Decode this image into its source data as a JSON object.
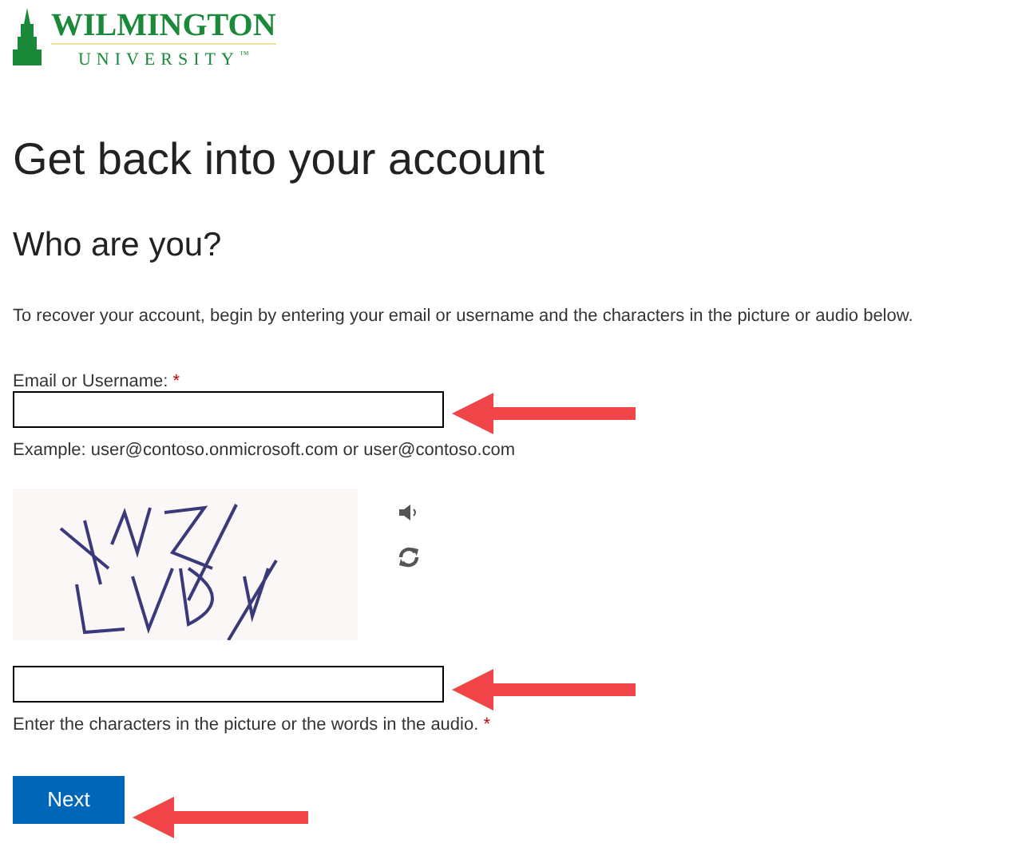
{
  "logo": {
    "name": "WILMINGTON",
    "subtitle": "UNIVERSITY",
    "mark": "™"
  },
  "title": "Get back into your account",
  "subtitle": "Who are you?",
  "instructions": "To recover your account, begin by entering your email or username and the characters in the picture or audio below.",
  "email_field": {
    "label": "Email or Username:",
    "required_mark": "*",
    "hint": "Example: user@contoso.onmicrosoft.com or user@contoso.com"
  },
  "captcha_field": {
    "label": "Enter the characters in the picture or the words in the audio.",
    "required_mark": "*"
  },
  "next_button": "Next"
}
